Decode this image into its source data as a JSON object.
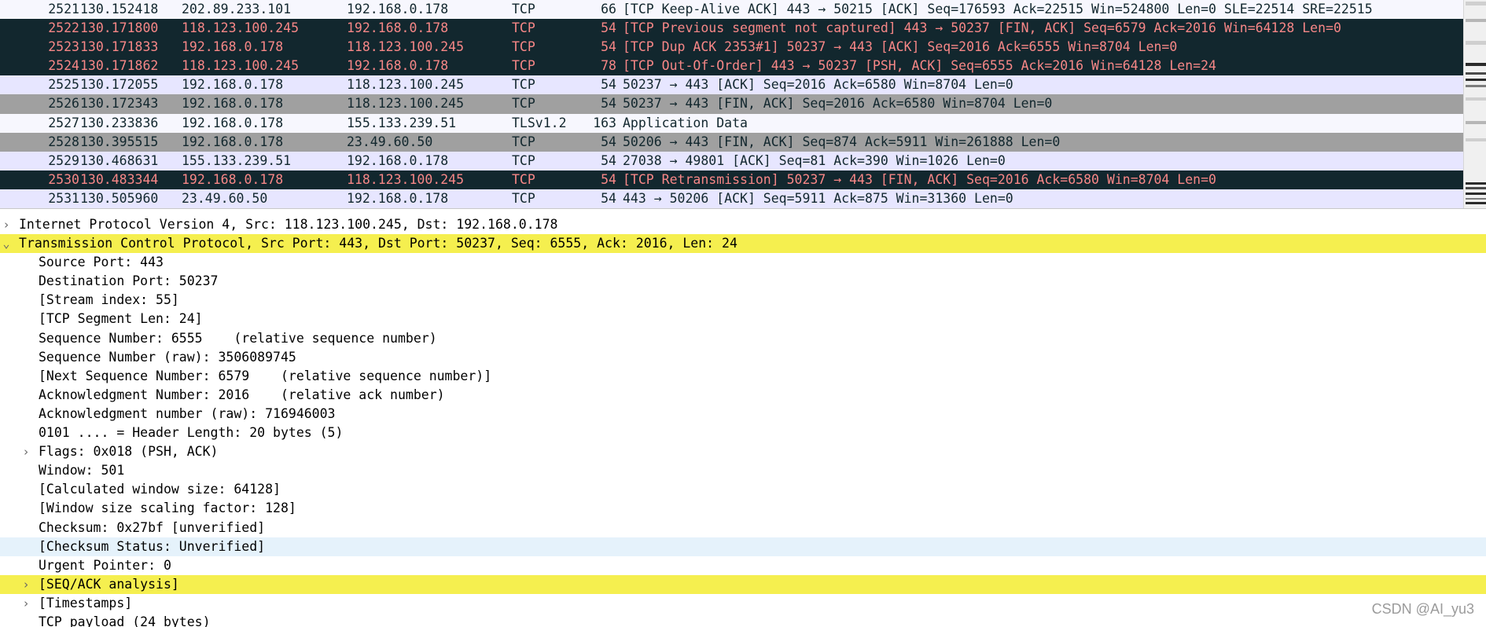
{
  "packets": [
    {
      "no": "2521",
      "time": "130.152418",
      "src": "202.89.233.101",
      "dst": "192.168.0.178",
      "proto": "TCP",
      "len": "66",
      "info": "[TCP Keep-Alive ACK] 443 → 50215 [ACK] Seq=176593 Ack=22515 Win=524800 Len=0 SLE=22514 SRE=22515"
    },
    {
      "no": "2522",
      "time": "130.171800",
      "src": "118.123.100.245",
      "dst": "192.168.0.178",
      "proto": "TCP",
      "len": "54",
      "info": "[TCP Previous segment not captured] 443 → 50237 [FIN, ACK] Seq=6579 Ack=2016 Win=64128 Len=0"
    },
    {
      "no": "2523",
      "time": "130.171833",
      "src": "192.168.0.178",
      "dst": "118.123.100.245",
      "proto": "TCP",
      "len": "54",
      "info": "[TCP Dup ACK 2353#1] 50237 → 443 [ACK] Seq=2016 Ack=6555 Win=8704 Len=0"
    },
    {
      "no": "2524",
      "time": "130.171862",
      "src": "118.123.100.245",
      "dst": "192.168.0.178",
      "proto": "TCP",
      "len": "78",
      "info": "[TCP Out-Of-Order] 443 → 50237 [PSH, ACK] Seq=6555 Ack=2016 Win=64128 Len=24"
    },
    {
      "no": "2525",
      "time": "130.172055",
      "src": "192.168.0.178",
      "dst": "118.123.100.245",
      "proto": "TCP",
      "len": "54",
      "info": "50237 → 443 [ACK] Seq=2016 Ack=6580 Win=8704 Len=0"
    },
    {
      "no": "2526",
      "time": "130.172343",
      "src": "192.168.0.178",
      "dst": "118.123.100.245",
      "proto": "TCP",
      "len": "54",
      "info": "50237 → 443 [FIN, ACK] Seq=2016 Ack=6580 Win=8704 Len=0"
    },
    {
      "no": "2527",
      "time": "130.233836",
      "src": "192.168.0.178",
      "dst": "155.133.239.51",
      "proto": "TLSv1.2",
      "len": "163",
      "info": "Application Data"
    },
    {
      "no": "2528",
      "time": "130.395515",
      "src": "192.168.0.178",
      "dst": "23.49.60.50",
      "proto": "TCP",
      "len": "54",
      "info": "50206 → 443 [FIN, ACK] Seq=874 Ack=5911 Win=261888 Len=0"
    },
    {
      "no": "2529",
      "time": "130.468631",
      "src": "155.133.239.51",
      "dst": "192.168.0.178",
      "proto": "TCP",
      "len": "54",
      "info": "27038 → 49801 [ACK] Seq=81 Ack=390 Win=1026 Len=0"
    },
    {
      "no": "2530",
      "time": "130.483344",
      "src": "192.168.0.178",
      "dst": "118.123.100.245",
      "proto": "TCP",
      "len": "54",
      "info": "[TCP Retransmission] 50237 → 443 [FIN, ACK] Seq=2016 Ack=6580 Win=8704 Len=0"
    },
    {
      "no": "2531",
      "time": "130.505960",
      "src": "23.49.60.50",
      "dst": "192.168.0.178",
      "proto": "TCP",
      "len": "54",
      "info": "443 → 50206 [ACK] Seq=5911 Ack=875 Win=31360 Len=0"
    }
  ],
  "details": [
    {
      "text": "Internet Protocol Version 4, Src: 118.123.100.245, Dst: 192.168.0.178",
      "chevron": "›"
    },
    {
      "text": "Transmission Control Protocol, Src Port: 443, Dst Port: 50237, Seq: 6555, Ack: 2016, Len: 24",
      "chevron": "⌄"
    },
    {
      "text": "Source Port: 443",
      "chevron": ""
    },
    {
      "text": "Destination Port: 50237",
      "chevron": ""
    },
    {
      "text": "[Stream index: 55]",
      "chevron": ""
    },
    {
      "text": "[TCP Segment Len: 24]",
      "chevron": ""
    },
    {
      "text": "Sequence Number: 6555    (relative sequence number)",
      "chevron": ""
    },
    {
      "text": "Sequence Number (raw): 3506089745",
      "chevron": ""
    },
    {
      "text": "[Next Sequence Number: 6579    (relative sequence number)]",
      "chevron": ""
    },
    {
      "text": "Acknowledgment Number: 2016    (relative ack number)",
      "chevron": ""
    },
    {
      "text": "Acknowledgment number (raw): 716946003",
      "chevron": ""
    },
    {
      "text": "0101 .... = Header Length: 20 bytes (5)",
      "chevron": ""
    },
    {
      "text": "Flags: 0x018 (PSH, ACK)",
      "chevron": "›"
    },
    {
      "text": "Window: 501",
      "chevron": ""
    },
    {
      "text": "[Calculated window size: 64128]",
      "chevron": ""
    },
    {
      "text": "[Window size scaling factor: 128]",
      "chevron": ""
    },
    {
      "text": "Checksum: 0x27bf [unverified]",
      "chevron": ""
    },
    {
      "text": "[Checksum Status: Unverified]",
      "chevron": ""
    },
    {
      "text": "Urgent Pointer: 0",
      "chevron": ""
    },
    {
      "text": "[SEQ/ACK analysis]",
      "chevron": "›"
    },
    {
      "text": "[Timestamps]",
      "chevron": "›"
    },
    {
      "text": "TCP payload (24 bytes)",
      "chevron": ""
    }
  ],
  "watermark": "CSDN @AI_yu3",
  "colors": {
    "row_dark_bg": "#12272e",
    "row_dark_fg": "#f78787",
    "row_lavender": "#e7e6ff",
    "row_gray": "#a0a0a0",
    "highlight_yellow": "#f5ef4f",
    "highlight_blue": "#e5f2fb"
  }
}
